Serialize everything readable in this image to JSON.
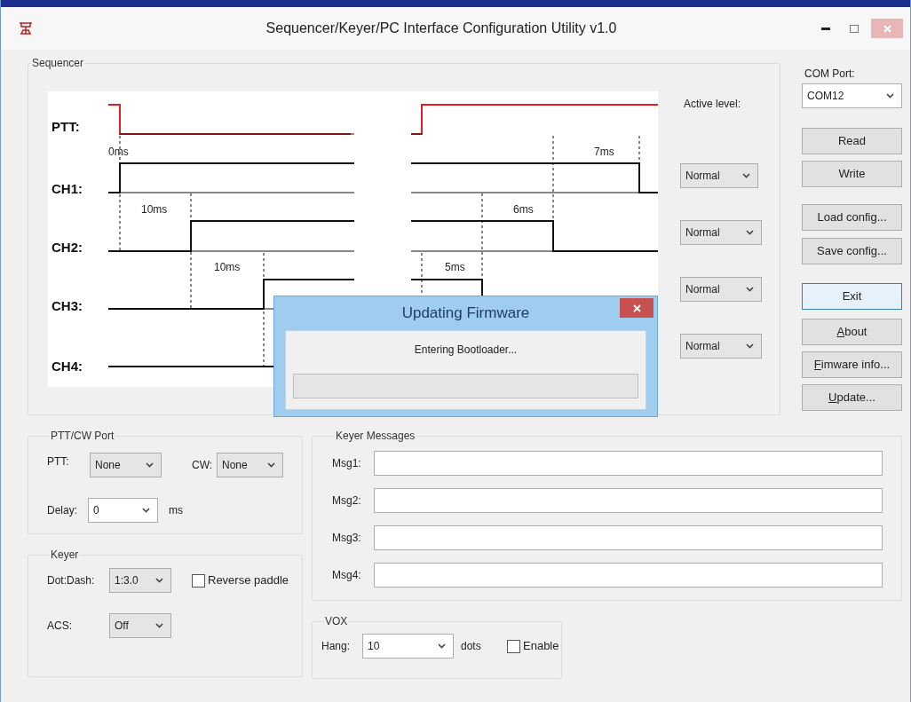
{
  "window": {
    "title": "Sequencer/Keyer/PC Interface Configuration Utility v1.0"
  },
  "sequencer": {
    "title": "Sequencer",
    "active_level_label": "Active level:",
    "channels": [
      {
        "label": "PTT:",
        "kind": "ptt"
      },
      {
        "label": "CH1:",
        "kind": "channel",
        "active_level": "Normal"
      },
      {
        "label": "CH2:",
        "kind": "channel",
        "active_level": "Normal"
      },
      {
        "label": "CH3:",
        "kind": "channel",
        "active_level": "Normal"
      },
      {
        "label": "CH4:",
        "kind": "channel",
        "active_level": "Normal"
      }
    ],
    "timings": [
      "0ms",
      "7ms",
      "10ms",
      "6ms",
      "10ms",
      "5ms"
    ]
  },
  "com_port": {
    "label": "COM Port:",
    "value": "COM12"
  },
  "buttons": [
    {
      "label": "Read",
      "underline_first": false,
      "focused": false
    },
    {
      "label": "Write",
      "underline_first": false,
      "focused": false
    },
    {
      "label": "Load config...",
      "underline_first": false,
      "focused": false
    },
    {
      "label": "Save config...",
      "underline_first": false,
      "focused": false
    },
    {
      "label": "Exit",
      "underline_first": false,
      "focused": true
    },
    {
      "label": "About",
      "underline_first": true,
      "focused": false
    },
    {
      "label": "Fimware info...",
      "underline_first": true,
      "focused": false
    },
    {
      "label": "Update...",
      "underline_first": true,
      "focused": false
    }
  ],
  "ptt_cw_port": {
    "title": "PTT/CW Port",
    "ptt_label": "PTT:",
    "ptt": "None",
    "cw_label": "CW:",
    "cw": "None",
    "delay_label": "Delay:",
    "delay": "0",
    "delay_unit": "ms"
  },
  "keyer": {
    "title": "Keyer",
    "dot_dash_label": "Dot:Dash:",
    "dot_dash": "1:3.0",
    "reverse_paddle": {
      "label": "Reverse paddle",
      "checked": false
    },
    "acs_label": "ACS:",
    "acs": "Off"
  },
  "keyer_messages": {
    "title": "Keyer Messages",
    "messages": [
      {
        "label": "Msg1:"
      },
      {
        "label": "Msg2:"
      },
      {
        "label": "Msg3:"
      },
      {
        "label": "Msg4:"
      }
    ]
  },
  "vox": {
    "title": "VOX",
    "hang_label": "Hang:",
    "hang": "10",
    "unit": "dots",
    "enable": {
      "label": "Enable",
      "checked": false
    }
  },
  "dialog": {
    "title": "Updating Firmware",
    "message": "Entering Bootloader..."
  }
}
